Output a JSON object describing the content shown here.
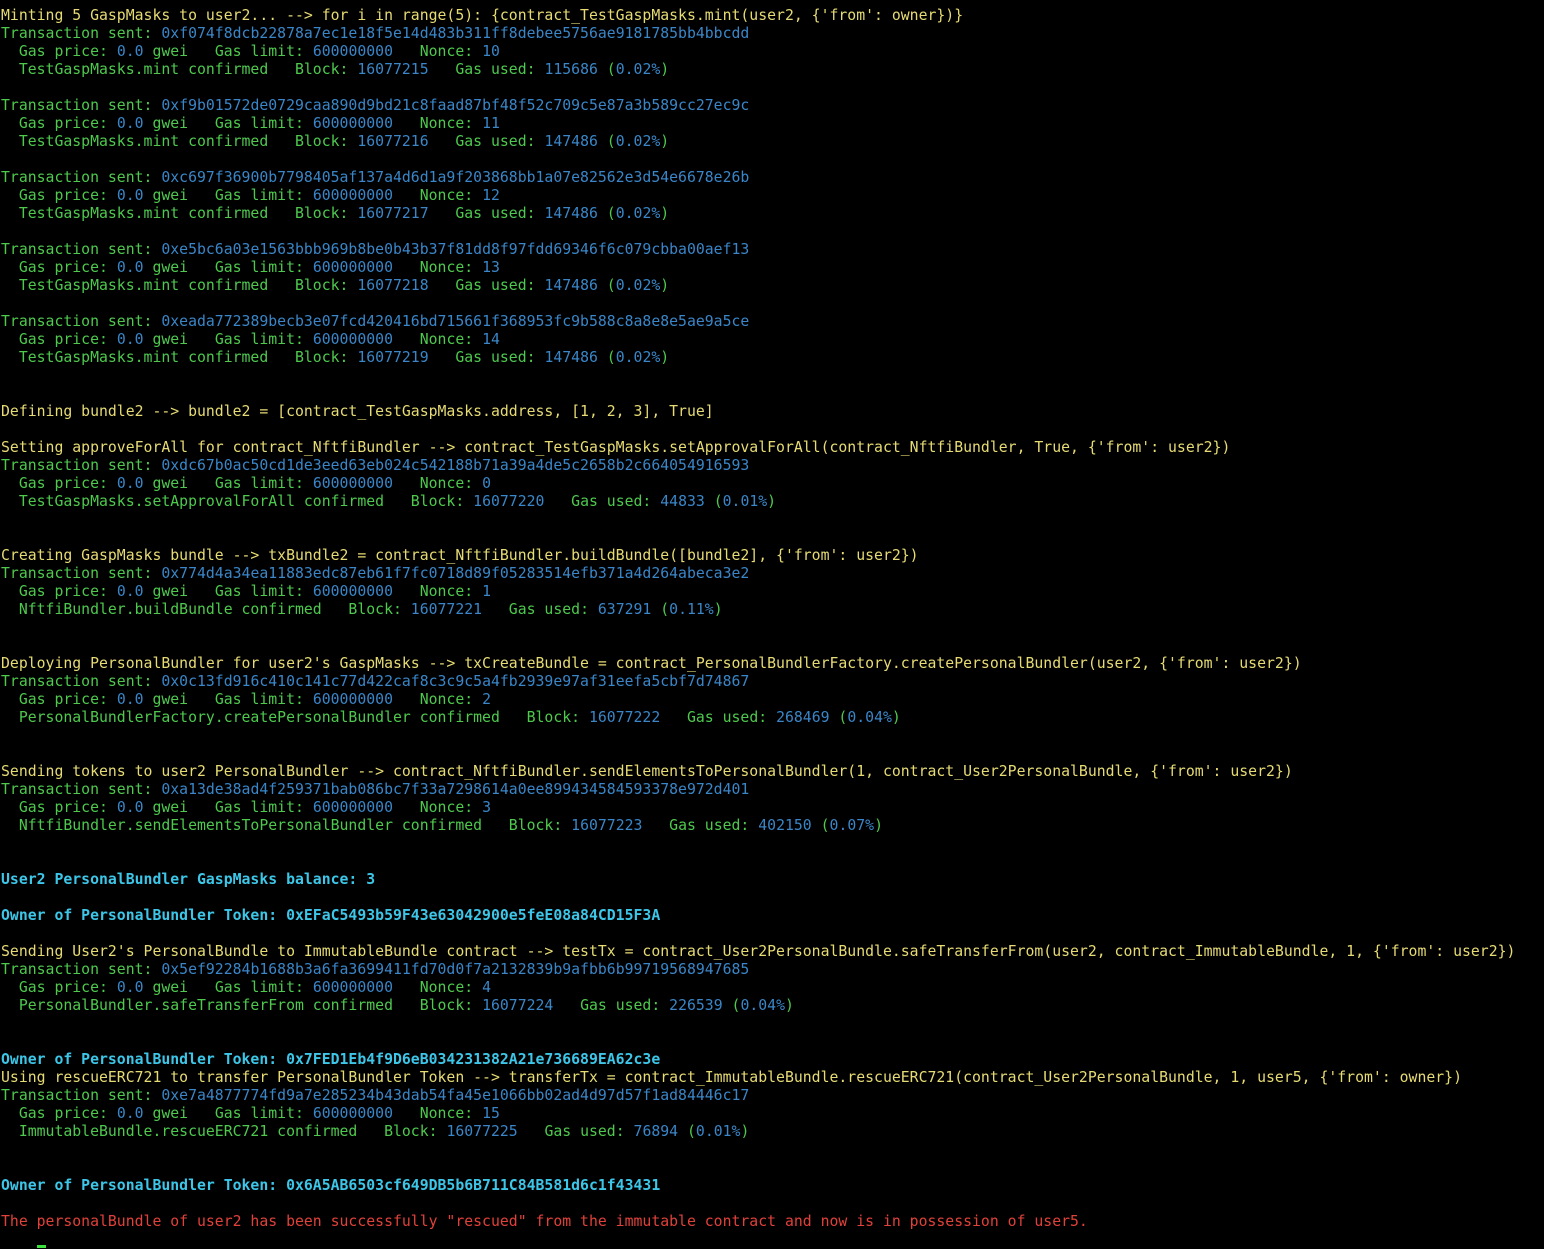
{
  "terminal": {
    "lines": [
      {
        "segs": [
          {
            "t": "Minting 5 GaspMasks to user2... --> for i in range(5): {contract_TestGaspMasks.mint(user2, {'from': owner})}",
            "c": "y"
          }
        ]
      },
      {
        "segs": [
          {
            "t": "Transaction sent: ",
            "c": "g"
          },
          {
            "t": "0xf074f8dcb22878a7ec1e18f5e14d483b311ff8debee5756ae9181785bb4bbcdd",
            "c": "b"
          }
        ]
      },
      {
        "segs": [
          {
            "t": "  Gas price: ",
            "c": "g"
          },
          {
            "t": "0.0",
            "c": "b"
          },
          {
            "t": " gwei   Gas limit: ",
            "c": "g"
          },
          {
            "t": "600000000",
            "c": "b"
          },
          {
            "t": "   Nonce: ",
            "c": "g"
          },
          {
            "t": "10",
            "c": "b"
          }
        ]
      },
      {
        "segs": [
          {
            "t": "  TestGaspMasks.mint confirmed   Block: ",
            "c": "g"
          },
          {
            "t": "16077215",
            "c": "b"
          },
          {
            "t": "   Gas used: ",
            "c": "g"
          },
          {
            "t": "115686",
            "c": "b"
          },
          {
            "t": " (",
            "c": "g"
          },
          {
            "t": "0.02%",
            "c": "b"
          },
          {
            "t": ")",
            "c": "g"
          }
        ]
      },
      {
        "segs": []
      },
      {
        "segs": [
          {
            "t": "Transaction sent: ",
            "c": "g"
          },
          {
            "t": "0xf9b01572de0729caa890d9bd21c8faad87bf48f52c709c5e87a3b589cc27ec9c",
            "c": "b"
          }
        ]
      },
      {
        "segs": [
          {
            "t": "  Gas price: ",
            "c": "g"
          },
          {
            "t": "0.0",
            "c": "b"
          },
          {
            "t": " gwei   Gas limit: ",
            "c": "g"
          },
          {
            "t": "600000000",
            "c": "b"
          },
          {
            "t": "   Nonce: ",
            "c": "g"
          },
          {
            "t": "11",
            "c": "b"
          }
        ]
      },
      {
        "segs": [
          {
            "t": "  TestGaspMasks.mint confirmed   Block: ",
            "c": "g"
          },
          {
            "t": "16077216",
            "c": "b"
          },
          {
            "t": "   Gas used: ",
            "c": "g"
          },
          {
            "t": "147486",
            "c": "b"
          },
          {
            "t": " (",
            "c": "g"
          },
          {
            "t": "0.02%",
            "c": "b"
          },
          {
            "t": ")",
            "c": "g"
          }
        ]
      },
      {
        "segs": []
      },
      {
        "segs": [
          {
            "t": "Transaction sent: ",
            "c": "g"
          },
          {
            "t": "0xc697f36900b7798405af137a4d6d1a9f203868bb1a07e82562e3d54e6678e26b",
            "c": "b"
          }
        ]
      },
      {
        "segs": [
          {
            "t": "  Gas price: ",
            "c": "g"
          },
          {
            "t": "0.0",
            "c": "b"
          },
          {
            "t": " gwei   Gas limit: ",
            "c": "g"
          },
          {
            "t": "600000000",
            "c": "b"
          },
          {
            "t": "   Nonce: ",
            "c": "g"
          },
          {
            "t": "12",
            "c": "b"
          }
        ]
      },
      {
        "segs": [
          {
            "t": "  TestGaspMasks.mint confirmed   Block: ",
            "c": "g"
          },
          {
            "t": "16077217",
            "c": "b"
          },
          {
            "t": "   Gas used: ",
            "c": "g"
          },
          {
            "t": "147486",
            "c": "b"
          },
          {
            "t": " (",
            "c": "g"
          },
          {
            "t": "0.02%",
            "c": "b"
          },
          {
            "t": ")",
            "c": "g"
          }
        ]
      },
      {
        "segs": []
      },
      {
        "segs": [
          {
            "t": "Transaction sent: ",
            "c": "g"
          },
          {
            "t": "0xe5bc6a03e1563bbb969b8be0b43b37f81dd8f97fdd69346f6c079cbba00aef13",
            "c": "b"
          }
        ]
      },
      {
        "segs": [
          {
            "t": "  Gas price: ",
            "c": "g"
          },
          {
            "t": "0.0",
            "c": "b"
          },
          {
            "t": " gwei   Gas limit: ",
            "c": "g"
          },
          {
            "t": "600000000",
            "c": "b"
          },
          {
            "t": "   Nonce: ",
            "c": "g"
          },
          {
            "t": "13",
            "c": "b"
          }
        ]
      },
      {
        "segs": [
          {
            "t": "  TestGaspMasks.mint confirmed   Block: ",
            "c": "g"
          },
          {
            "t": "16077218",
            "c": "b"
          },
          {
            "t": "   Gas used: ",
            "c": "g"
          },
          {
            "t": "147486",
            "c": "b"
          },
          {
            "t": " (",
            "c": "g"
          },
          {
            "t": "0.02%",
            "c": "b"
          },
          {
            "t": ")",
            "c": "g"
          }
        ]
      },
      {
        "segs": []
      },
      {
        "segs": [
          {
            "t": "Transaction sent: ",
            "c": "g"
          },
          {
            "t": "0xeada772389becb3e07fcd420416bd715661f368953fc9b588c8a8e8e5ae9a5ce",
            "c": "b"
          }
        ]
      },
      {
        "segs": [
          {
            "t": "  Gas price: ",
            "c": "g"
          },
          {
            "t": "0.0",
            "c": "b"
          },
          {
            "t": " gwei   Gas limit: ",
            "c": "g"
          },
          {
            "t": "600000000",
            "c": "b"
          },
          {
            "t": "   Nonce: ",
            "c": "g"
          },
          {
            "t": "14",
            "c": "b"
          }
        ]
      },
      {
        "segs": [
          {
            "t": "  TestGaspMasks.mint confirmed   Block: ",
            "c": "g"
          },
          {
            "t": "16077219",
            "c": "b"
          },
          {
            "t": "   Gas used: ",
            "c": "g"
          },
          {
            "t": "147486",
            "c": "b"
          },
          {
            "t": " (",
            "c": "g"
          },
          {
            "t": "0.02%",
            "c": "b"
          },
          {
            "t": ")",
            "c": "g"
          }
        ]
      },
      {
        "segs": []
      },
      {
        "segs": []
      },
      {
        "segs": [
          {
            "t": "Defining bundle2 --> bundle2 = [contract_TestGaspMasks.address, [1, 2, 3], True]",
            "c": "y"
          }
        ]
      },
      {
        "segs": []
      },
      {
        "segs": [
          {
            "t": "Setting approveForAll for contract_NftfiBundler --> contract_TestGaspMasks.setApprovalForAll(contract_NftfiBundler, True, {'from': user2})",
            "c": "y"
          }
        ]
      },
      {
        "segs": [
          {
            "t": "Transaction sent: ",
            "c": "g"
          },
          {
            "t": "0xdc67b0ac50cd1de3eed63eb024c542188b71a39a4de5c2658b2c664054916593",
            "c": "b"
          }
        ]
      },
      {
        "segs": [
          {
            "t": "  Gas price: ",
            "c": "g"
          },
          {
            "t": "0.0",
            "c": "b"
          },
          {
            "t": " gwei   Gas limit: ",
            "c": "g"
          },
          {
            "t": "600000000",
            "c": "b"
          },
          {
            "t": "   Nonce: ",
            "c": "g"
          },
          {
            "t": "0",
            "c": "b"
          }
        ]
      },
      {
        "segs": [
          {
            "t": "  TestGaspMasks.setApprovalForAll confirmed   Block: ",
            "c": "g"
          },
          {
            "t": "16077220",
            "c": "b"
          },
          {
            "t": "   Gas used: ",
            "c": "g"
          },
          {
            "t": "44833",
            "c": "b"
          },
          {
            "t": " (",
            "c": "g"
          },
          {
            "t": "0.01%",
            "c": "b"
          },
          {
            "t": ")",
            "c": "g"
          }
        ]
      },
      {
        "segs": []
      },
      {
        "segs": []
      },
      {
        "segs": [
          {
            "t": "Creating GaspMasks bundle --> txBundle2 = contract_NftfiBundler.buildBundle([bundle2], {'from': user2})",
            "c": "y"
          }
        ]
      },
      {
        "segs": [
          {
            "t": "Transaction sent: ",
            "c": "g"
          },
          {
            "t": "0x774d4a34ea11883edc87eb61f7fc0718d89f05283514efb371a4d264abeca3e2",
            "c": "b"
          }
        ]
      },
      {
        "segs": [
          {
            "t": "  Gas price: ",
            "c": "g"
          },
          {
            "t": "0.0",
            "c": "b"
          },
          {
            "t": " gwei   Gas limit: ",
            "c": "g"
          },
          {
            "t": "600000000",
            "c": "b"
          },
          {
            "t": "   Nonce: ",
            "c": "g"
          },
          {
            "t": "1",
            "c": "b"
          }
        ]
      },
      {
        "segs": [
          {
            "t": "  NftfiBundler.buildBundle confirmed   Block: ",
            "c": "g"
          },
          {
            "t": "16077221",
            "c": "b"
          },
          {
            "t": "   Gas used: ",
            "c": "g"
          },
          {
            "t": "637291",
            "c": "b"
          },
          {
            "t": " (",
            "c": "g"
          },
          {
            "t": "0.11%",
            "c": "b"
          },
          {
            "t": ")",
            "c": "g"
          }
        ]
      },
      {
        "segs": []
      },
      {
        "segs": []
      },
      {
        "segs": [
          {
            "t": "Deploying PersonalBundler for user2's GaspMasks --> txCreateBundle = contract_PersonalBundlerFactory.createPersonalBundler(user2, {'from': user2})",
            "c": "y"
          }
        ]
      },
      {
        "segs": [
          {
            "t": "Transaction sent: ",
            "c": "g"
          },
          {
            "t": "0x0c13fd916c410c141c77d422caf8c3c9c5a4fb2939e97af31eefa5cbf7d74867",
            "c": "b"
          }
        ]
      },
      {
        "segs": [
          {
            "t": "  Gas price: ",
            "c": "g"
          },
          {
            "t": "0.0",
            "c": "b"
          },
          {
            "t": " gwei   Gas limit: ",
            "c": "g"
          },
          {
            "t": "600000000",
            "c": "b"
          },
          {
            "t": "   Nonce: ",
            "c": "g"
          },
          {
            "t": "2",
            "c": "b"
          }
        ]
      },
      {
        "segs": [
          {
            "t": "  PersonalBundlerFactory.createPersonalBundler confirmed   Block: ",
            "c": "g"
          },
          {
            "t": "16077222",
            "c": "b"
          },
          {
            "t": "   Gas used: ",
            "c": "g"
          },
          {
            "t": "268469",
            "c": "b"
          },
          {
            "t": " (",
            "c": "g"
          },
          {
            "t": "0.04%",
            "c": "b"
          },
          {
            "t": ")",
            "c": "g"
          }
        ]
      },
      {
        "segs": []
      },
      {
        "segs": []
      },
      {
        "segs": [
          {
            "t": "Sending tokens to user2 PersonalBundler --> contract_NftfiBundler.sendElementsToPersonalBundler(1, contract_User2PersonalBundle, {'from': user2})",
            "c": "y"
          }
        ]
      },
      {
        "segs": [
          {
            "t": "Transaction sent: ",
            "c": "g"
          },
          {
            "t": "0xa13de38ad4f259371bab086bc7f33a7298614a0ee899434584593378e972d401",
            "c": "b"
          }
        ]
      },
      {
        "segs": [
          {
            "t": "  Gas price: ",
            "c": "g"
          },
          {
            "t": "0.0",
            "c": "b"
          },
          {
            "t": " gwei   Gas limit: ",
            "c": "g"
          },
          {
            "t": "600000000",
            "c": "b"
          },
          {
            "t": "   Nonce: ",
            "c": "g"
          },
          {
            "t": "3",
            "c": "b"
          }
        ]
      },
      {
        "segs": [
          {
            "t": "  NftfiBundler.sendElementsToPersonalBundler confirmed   Block: ",
            "c": "g"
          },
          {
            "t": "16077223",
            "c": "b"
          },
          {
            "t": "   Gas used: ",
            "c": "g"
          },
          {
            "t": "402150",
            "c": "b"
          },
          {
            "t": " (",
            "c": "g"
          },
          {
            "t": "0.07%",
            "c": "b"
          },
          {
            "t": ")",
            "c": "g"
          }
        ]
      },
      {
        "segs": []
      },
      {
        "segs": []
      },
      {
        "segs": [
          {
            "t": "User2 PersonalBundler GaspMasks balance: 3",
            "c": "c"
          }
        ]
      },
      {
        "segs": []
      },
      {
        "segs": [
          {
            "t": "Owner of PersonalBundler Token: 0xEFaC5493b59F43e63042900e5feE08a84CD15F3A",
            "c": "c"
          }
        ]
      },
      {
        "segs": []
      },
      {
        "segs": [
          {
            "t": "Sending User2's PersonalBundle to ImmutableBundle contract --> testTx = contract_User2PersonalBundle.safeTransferFrom(user2, contract_ImmutableBundle, 1, {'from': user2})",
            "c": "y"
          }
        ]
      },
      {
        "segs": [
          {
            "t": "Transaction sent: ",
            "c": "g"
          },
          {
            "t": "0x5ef92284b1688b3a6fa3699411fd70d0f7a2132839b9afbb6b99719568947685",
            "c": "b"
          }
        ]
      },
      {
        "segs": [
          {
            "t": "  Gas price: ",
            "c": "g"
          },
          {
            "t": "0.0",
            "c": "b"
          },
          {
            "t": " gwei   Gas limit: ",
            "c": "g"
          },
          {
            "t": "600000000",
            "c": "b"
          },
          {
            "t": "   Nonce: ",
            "c": "g"
          },
          {
            "t": "4",
            "c": "b"
          }
        ]
      },
      {
        "segs": [
          {
            "t": "  PersonalBundler.safeTransferFrom confirmed   Block: ",
            "c": "g"
          },
          {
            "t": "16077224",
            "c": "b"
          },
          {
            "t": "   Gas used: ",
            "c": "g"
          },
          {
            "t": "226539",
            "c": "b"
          },
          {
            "t": " (",
            "c": "g"
          },
          {
            "t": "0.04%",
            "c": "b"
          },
          {
            "t": ")",
            "c": "g"
          }
        ]
      },
      {
        "segs": []
      },
      {
        "segs": []
      },
      {
        "segs": [
          {
            "t": "Owner of PersonalBundler Token: 0x7FED1Eb4f9D6eB034231382A21e736689EA62c3e",
            "c": "c"
          }
        ]
      },
      {
        "segs": [
          {
            "t": "Using rescueERC721 to transfer PersonalBundler Token --> transferTx = contract_ImmutableBundle.rescueERC721(contract_User2PersonalBundle, 1, user5, {'from': owner})",
            "c": "y"
          }
        ]
      },
      {
        "segs": [
          {
            "t": "Transaction sent: ",
            "c": "g"
          },
          {
            "t": "0xe7a4877774fd9a7e285234b43dab54fa45e1066bb02ad4d97d57f1ad84446c17",
            "c": "b"
          }
        ]
      },
      {
        "segs": [
          {
            "t": "  Gas price: ",
            "c": "g"
          },
          {
            "t": "0.0",
            "c": "b"
          },
          {
            "t": " gwei   Gas limit: ",
            "c": "g"
          },
          {
            "t": "600000000",
            "c": "b"
          },
          {
            "t": "   Nonce: ",
            "c": "g"
          },
          {
            "t": "15",
            "c": "b"
          }
        ]
      },
      {
        "segs": [
          {
            "t": "  ImmutableBundle.rescueERC721 confirmed   Block: ",
            "c": "g"
          },
          {
            "t": "16077225",
            "c": "b"
          },
          {
            "t": "   Gas used: ",
            "c": "g"
          },
          {
            "t": "76894",
            "c": "b"
          },
          {
            "t": " (",
            "c": "g"
          },
          {
            "t": "0.01%",
            "c": "b"
          },
          {
            "t": ")",
            "c": "g"
          }
        ]
      },
      {
        "segs": []
      },
      {
        "segs": []
      },
      {
        "segs": [
          {
            "t": "Owner of PersonalBundler Token: 0x6A5AB6503cf649DB5b6B711C84B581d6c1f43431",
            "c": "c"
          }
        ]
      },
      {
        "segs": []
      },
      {
        "segs": [
          {
            "t": "The personalBundle of user2 has been successfully \"rescued\" from the immutable contract and now is in possession of user5.",
            "c": "r"
          }
        ]
      }
    ]
  }
}
